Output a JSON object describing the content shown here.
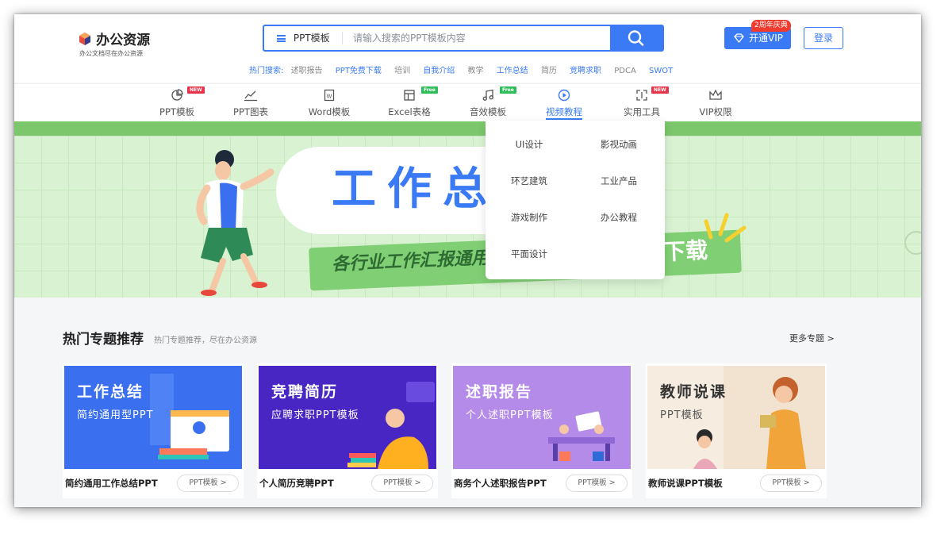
{
  "logo": {
    "name": "办公资源",
    "slogan": "办公文档尽在办公资源"
  },
  "search": {
    "category": "PPT模板",
    "placeholder": "请输入搜索的PPT模板内容"
  },
  "vip": {
    "label": "开通VIP",
    "badge": "2周年庆典"
  },
  "login": {
    "label": "登录"
  },
  "hot_search": {
    "label": "热门搜索:",
    "items": [
      {
        "text": "述职报告",
        "highlight": false
      },
      {
        "text": "PPT免费下载",
        "highlight": true
      },
      {
        "text": "培训",
        "highlight": false
      },
      {
        "text": "自我介绍",
        "highlight": true
      },
      {
        "text": "教学",
        "highlight": false
      },
      {
        "text": "工作总结",
        "highlight": true
      },
      {
        "text": "简历",
        "highlight": false
      },
      {
        "text": "竞聘求职",
        "highlight": true
      },
      {
        "text": "PDCA",
        "highlight": false
      },
      {
        "text": "SWOT",
        "highlight": true
      }
    ]
  },
  "nav": {
    "items": [
      {
        "label": "PPT模板",
        "icon": "pie-chart-icon",
        "badge": "NEW"
      },
      {
        "label": "PPT图表",
        "icon": "line-chart-icon",
        "badge": ""
      },
      {
        "label": "Word模板",
        "icon": "word-doc-icon",
        "badge": ""
      },
      {
        "label": "Excel表格",
        "icon": "excel-table-icon",
        "badge": "Free"
      },
      {
        "label": "音效模板",
        "icon": "music-note-icon",
        "badge": "Free"
      },
      {
        "label": "视频教程",
        "icon": "play-circle-icon",
        "badge": "",
        "active": true
      },
      {
        "label": "实用工具",
        "icon": "tool-frame-icon",
        "badge": "NEW"
      },
      {
        "label": "VIP权限",
        "icon": "crown-icon",
        "badge": ""
      }
    ]
  },
  "dropdown": {
    "items": [
      "UI设计",
      "影视动画",
      "环艺建筑",
      "工业产品",
      "游戏制作",
      "办公教程",
      "平面设计"
    ]
  },
  "banner": {
    "title": "工作总",
    "subtitle": "各行业工作汇报通用",
    "subtitle_end": "下载"
  },
  "section": {
    "title": "热门专题推荐",
    "subtitle": "热门专题推荐，尽在办公资源",
    "more": "更多专题 >"
  },
  "cards": [
    {
      "title": "工作总结",
      "subtitle": "简约通用型PPT",
      "name": "简约通用工作总结PPT",
      "tag": "PPT模板 >",
      "color": "#3a6ff0"
    },
    {
      "title": "竞聘简历",
      "subtitle": "应聘求职PPT模板",
      "name": "个人简历竞聘PPT",
      "tag": "PPT模板 >",
      "color": "#4826c4"
    },
    {
      "title": "述职报告",
      "subtitle": "个人述职PPT模板",
      "name": "商务个人述职报告PPT",
      "tag": "PPT模板 >",
      "color": "#b48be8"
    },
    {
      "title": "教师说课",
      "subtitle": "PPT模板",
      "name": "教师说课PPT模板",
      "tag": "PPT模板 >",
      "color": "#f6ece0"
    }
  ],
  "colors": {
    "accent": "#3a7bf5",
    "banner_green": "#7cc66c",
    "badge_red": "#e8344a",
    "badge_green": "#2ebd59"
  }
}
